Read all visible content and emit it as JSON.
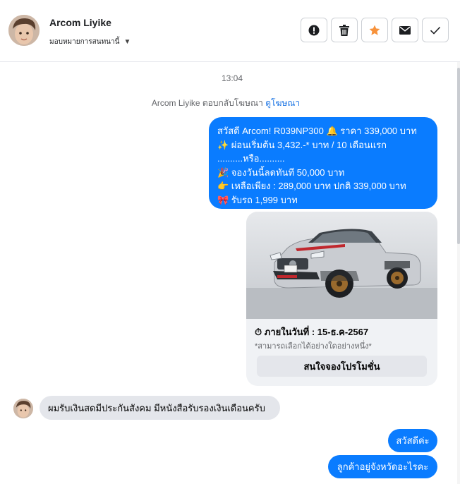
{
  "header": {
    "contact_name": "Arcom Liyike",
    "assign_label": "มอบหมายการสนทนานี้",
    "actions": [
      {
        "name": "report-icon",
        "color": "#1c1e21"
      },
      {
        "name": "trash-icon",
        "color": "#1c1e21"
      },
      {
        "name": "star-icon",
        "color": "#f7923b"
      },
      {
        "name": "mail-icon",
        "color": "#1c1e21"
      },
      {
        "name": "check-icon",
        "color": "#1c1e21"
      }
    ]
  },
  "thread": {
    "timestamp": "13:04",
    "reply_note": "Arcom Liyike ตอบกลับโฆษณา",
    "reply_link": "ดูโฆษณา",
    "promo_lines": [
      "สวัสดี Arcom!  R039NP300 🔔 ราคา 339,000 บาท",
      "✨ ผ่อนเริ่มต้น 3,432.-* บาท / 10 เดือนแรก",
      "..........หรือ..........",
      "🎉 จองวันนี้ลดทันที 50,000 บาท",
      "👉 เหลือเพียง : 289,000 บาท ปกติ 339,000 บาท",
      "🎀 รับรถ 1,999 บาท"
    ],
    "card": {
      "date_line": "⏱ ภายในวันที่ : 15-ธ.ค-2567",
      "note": "*สามารถเลือกได้อย่างใดอย่างหนึ่ง*",
      "button": "สนใจจองโปรโมชั่น"
    },
    "incoming_message": "ผมรับเงินสดมีประกันสังคม มีหนังสือรับรองเงินเดือนครับ",
    "outgoing_messages": [
      "สวัสดีค่ะ",
      "ลูกค้าอยู่จังหวัดอะไรคะ"
    ]
  },
  "colors": {
    "bubble_out": "#0a7cff",
    "bubble_in": "#e4e6eb",
    "link": "#1b74e4",
    "star": "#f7923b"
  }
}
